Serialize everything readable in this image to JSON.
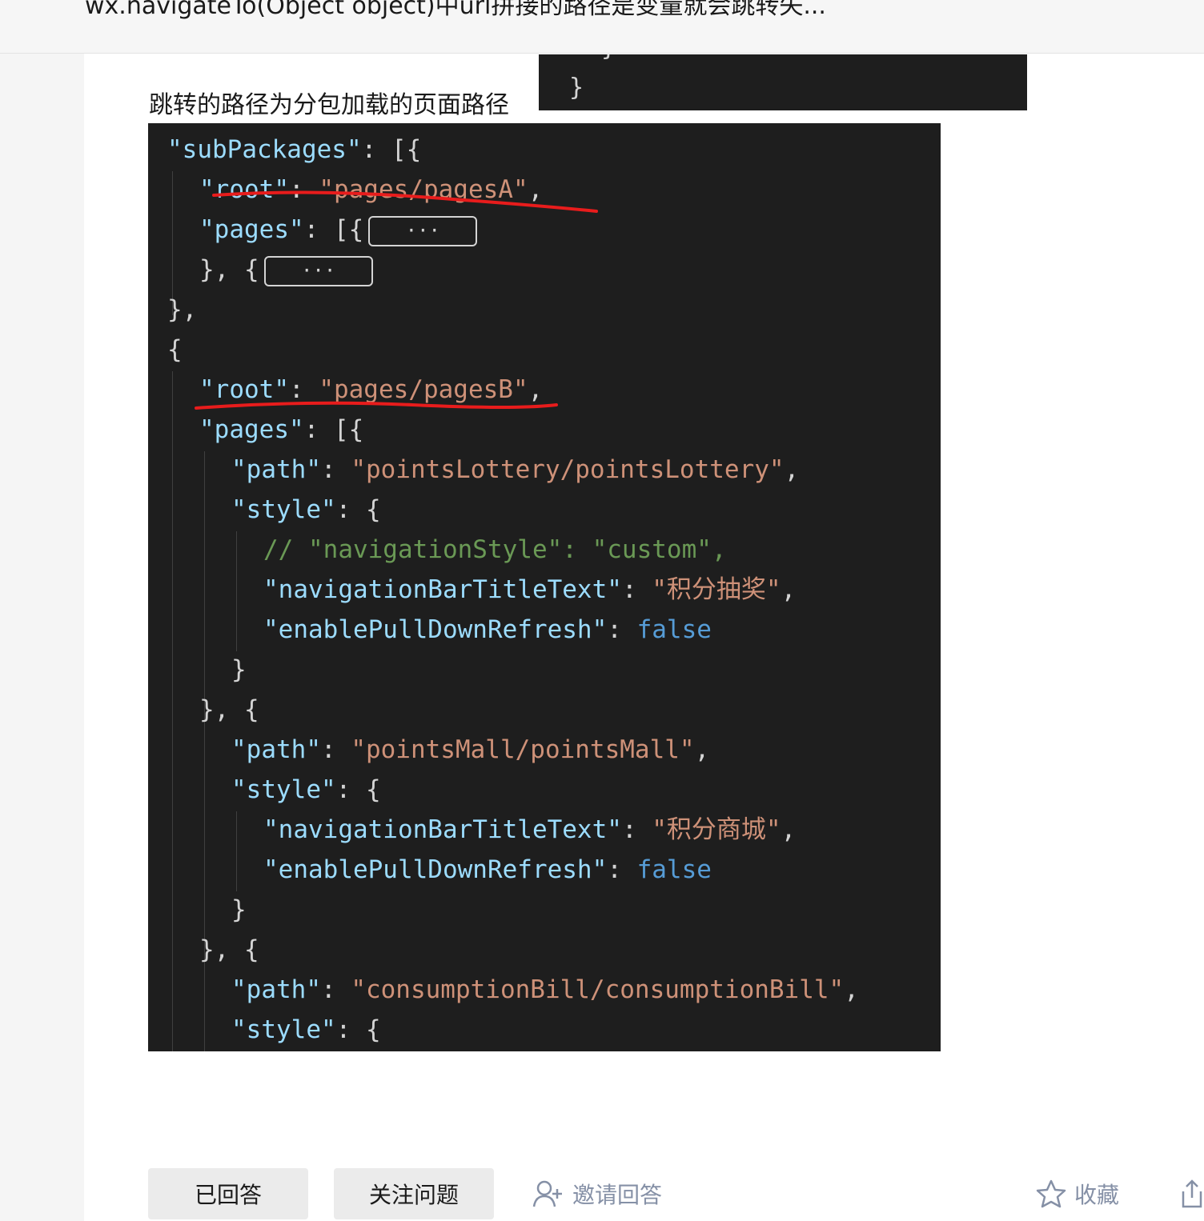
{
  "header": {
    "question_title": "wx.navigateTo(Object object)中url拼接的路径是变量就会跳转失..."
  },
  "answer": {
    "intro_text": "跳转的路径为分包加载的页面路径",
    "snippet_lines": [
      "}",
      "}"
    ],
    "code": {
      "subpackages_key": "\"subPackages\"",
      "root_key": "\"root\"",
      "pages_key": "\"pages\"",
      "path_key": "\"path\"",
      "style_key": "\"style\"",
      "root_a": "\"pages/pagesA\"",
      "root_b": "\"pages/pagesB\"",
      "fold_label": "···",
      "comment_line": "// \"navigationStyle\": \"custom\",",
      "nav_title_key": "\"navigationBarTitleText\"",
      "pull_refresh_key": "\"enablePullDownRefresh\"",
      "false_value": "false",
      "path_1": "\"pointsLottery/pointsLottery\"",
      "title_1": "\"积分抽奖\"",
      "path_2": "\"pointsMall/pointsMall\"",
      "title_2": "\"积分商城\"",
      "path_3": "\"consumptionBill/consumptionBill\""
    }
  },
  "actions": {
    "answered_label": "已回答",
    "follow_label": "关注问题",
    "invite_label": "邀请回答",
    "favorite_label": "收藏"
  },
  "colors": {
    "code_bg": "#1e1e1e",
    "key": "#9cdcfe",
    "string": "#ce9178",
    "boolean": "#569cd6",
    "comment": "#6a9955",
    "annotation": "#e81c1c",
    "muted_link": "#8590a6"
  }
}
